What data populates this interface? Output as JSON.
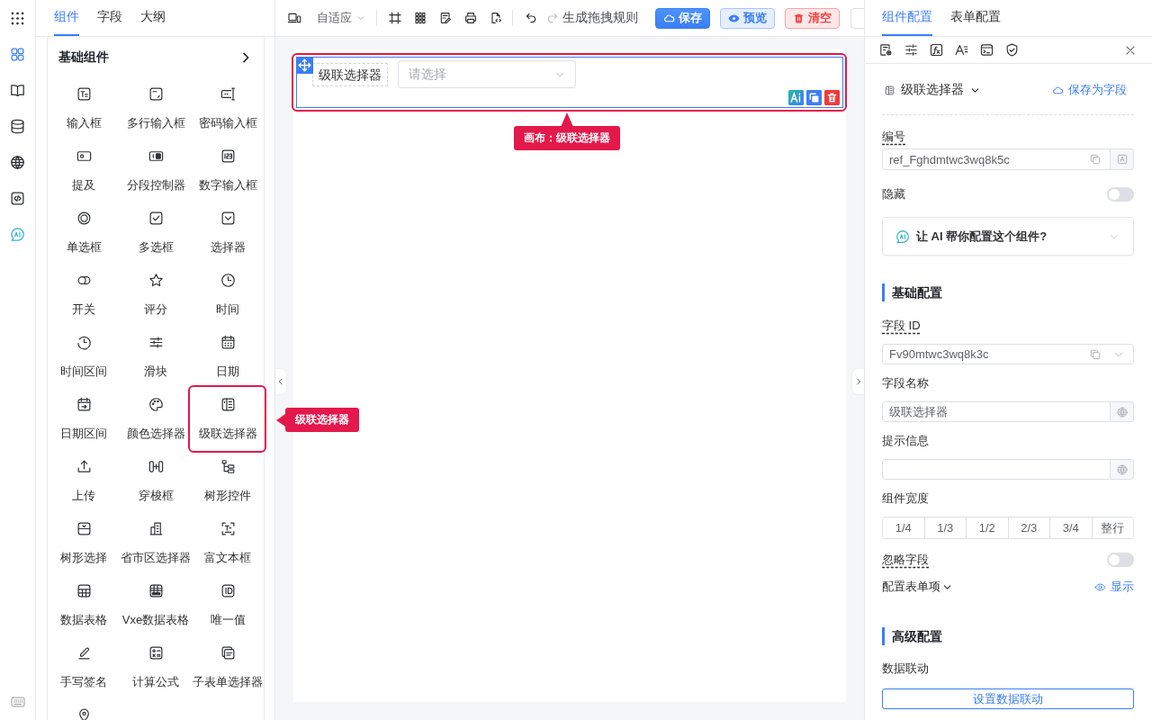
{
  "rail": {
    "items": [
      {
        "selected": true
      },
      {
        "selected": false
      },
      {
        "selected": false
      },
      {
        "selected": false
      },
      {
        "selected": false
      },
      {
        "selected": false
      }
    ]
  },
  "left_tabs": [
    {
      "label": "组件",
      "selected": true
    },
    {
      "label": "字段",
      "selected": false
    },
    {
      "label": "大纲",
      "selected": false
    }
  ],
  "component_panel": {
    "title": "基础组件",
    "items": [
      {
        "label": "输入框",
        "highlighted": false
      },
      {
        "label": "多行输入框",
        "highlighted": false
      },
      {
        "label": "密码输入框",
        "highlighted": false
      },
      {
        "label": "提及",
        "highlighted": false
      },
      {
        "label": "分段控制器",
        "highlighted": false
      },
      {
        "label": "数字输入框",
        "highlighted": false
      },
      {
        "label": "单选框",
        "highlighted": false
      },
      {
        "label": "多选框",
        "highlighted": false
      },
      {
        "label": "选择器",
        "highlighted": false
      },
      {
        "label": "开关",
        "highlighted": false
      },
      {
        "label": "评分",
        "highlighted": false
      },
      {
        "label": "时间",
        "highlighted": false
      },
      {
        "label": "时间区间",
        "highlighted": false
      },
      {
        "label": "滑块",
        "highlighted": false
      },
      {
        "label": "日期",
        "highlighted": false
      },
      {
        "label": "日期区间",
        "highlighted": false
      },
      {
        "label": "颜色选择器",
        "highlighted": false
      },
      {
        "label": "级联选择器",
        "highlighted": true
      },
      {
        "label": "上传",
        "highlighted": false
      },
      {
        "label": "穿梭框",
        "highlighted": false
      },
      {
        "label": "树形控件",
        "highlighted": false
      },
      {
        "label": "树形选择",
        "highlighted": false
      },
      {
        "label": "省市区选择器",
        "highlighted": false
      },
      {
        "label": "富文本框",
        "highlighted": false
      },
      {
        "label": "数据表格",
        "highlighted": false
      },
      {
        "label": "Vxe数据表格",
        "highlighted": false
      },
      {
        "label": "唯一值",
        "highlighted": false
      },
      {
        "label": "手写签名",
        "highlighted": false
      },
      {
        "label": "计算公式",
        "highlighted": false
      },
      {
        "label": "子表单选择器",
        "highlighted": false
      },
      {
        "highlighted": false
      }
    ],
    "callout": "级联选择器"
  },
  "toolbar": {
    "layout": "自适应",
    "history": [
      {
        "disabled": false
      },
      {
        "disabled": true
      }
    ],
    "rule_action": "生成拖拽规则",
    "buttons": [
      {
        "label": "保存",
        "kind": "primary"
      },
      {
        "label": "预览",
        "kind": "info"
      },
      {
        "label": "清空",
        "kind": "danger"
      }
    ]
  },
  "canvas": {
    "field": {
      "label": "级联选择器",
      "placeholder": "请选择",
      "selected": true,
      "highlighted": true,
      "callout": "画布：级联选择器"
    }
  },
  "right_tabs": [
    {
      "label": "组件配置",
      "selected": true
    },
    {
      "label": "表单配置",
      "selected": false
    }
  ],
  "config": {
    "component": {
      "name": "级联选择器",
      "save_action": "保存为字段"
    },
    "ref": {
      "label": "编号",
      "value": "ref_Fghdmtwc3wq8k5c"
    },
    "hidden": {
      "label": "隐藏",
      "on": false
    },
    "ai_prompt": "让 AI 帮你配置这个组件?",
    "basic": {
      "title": "基础配置",
      "field_id": {
        "label": "字段 ID",
        "value": "Fv90mtwc3wq8k3c"
      },
      "field_name": {
        "label": "字段名称",
        "value": "级联选择器"
      },
      "hint": {
        "label": "提示信息"
      },
      "width": {
        "label": "组件宽度",
        "options": [
          {
            "label": "1/4",
            "selected": false
          },
          {
            "label": "1/3",
            "selected": false
          },
          {
            "label": "1/2",
            "selected": false
          },
          {
            "label": "2/3",
            "selected": false
          },
          {
            "label": "3/4",
            "selected": false
          },
          {
            "label": "整行",
            "selected": false
          }
        ]
      },
      "ignore": {
        "label": "忽略字段",
        "on": false
      },
      "form_items": {
        "label": "配置表单项",
        "action": "显示"
      }
    },
    "advanced": {
      "title": "高级配置",
      "linkage": {
        "label": "数据联动",
        "button": "设置数据联动"
      }
    }
  }
}
